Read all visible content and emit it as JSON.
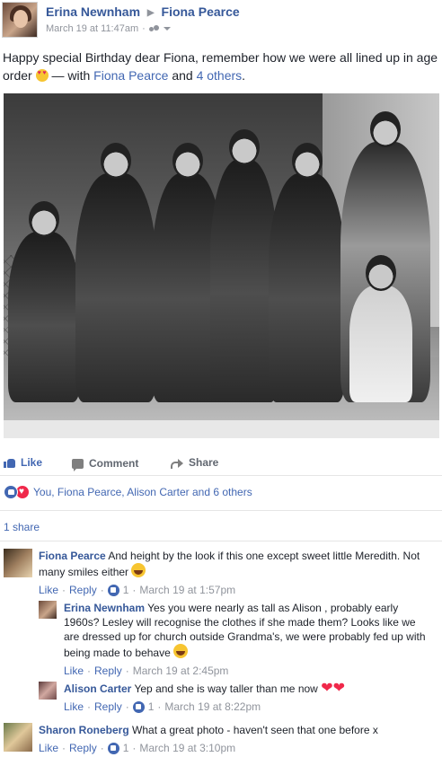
{
  "post": {
    "author": "Erina Newnham",
    "target": "Fiona Pearce",
    "timestamp": "March 19 at 11:47am",
    "audience_icon": "friends-icon",
    "text_main": "Happy special Birthday dear Fiona, remember how we were all lined up in age order",
    "text_with": " — with ",
    "tagged_person": "Fiona Pearce",
    "text_and": " and ",
    "tagged_others": "4 others",
    "text_end": "."
  },
  "actions": {
    "like": "Like",
    "comment": "Comment",
    "share": "Share"
  },
  "reactions": {
    "summary": "You, Fiona Pearce, Alison Carter and 6 others"
  },
  "shares": {
    "label": "1 share"
  },
  "comments": [
    {
      "author": "Fiona Pearce",
      "text": "And height by the look if this one except sweet little Meredith. Not many smiles either",
      "like": "Like",
      "reply": "Reply",
      "like_count": "1",
      "time": "March 19 at 1:57pm"
    },
    {
      "author": "Erina Newnham",
      "text": "Yes you were nearly as tall as Alison , probably early 1960s? Lesley will recognise the clothes if she made them? Looks like we are dressed up for church outside Grandma's, we were probably fed up with being made to behave",
      "like": "Like",
      "reply": "Reply",
      "time": "March 19 at 2:45pm"
    },
    {
      "author": "Alison Carter",
      "text": "Yep and she is way taller than me now",
      "like": "Like",
      "reply": "Reply",
      "like_count": "1",
      "time": "March 19 at 8:22pm"
    },
    {
      "author": "Sharon Roneberg",
      "text": "What a great photo - haven't seen that one before x",
      "like": "Like",
      "reply": "Reply",
      "like_count": "1",
      "time": "March 19 at 3:10pm"
    }
  ],
  "colors": {
    "link": "#4267b2",
    "name": "#365899",
    "meta": "#90949c",
    "love": "#f0284a"
  }
}
